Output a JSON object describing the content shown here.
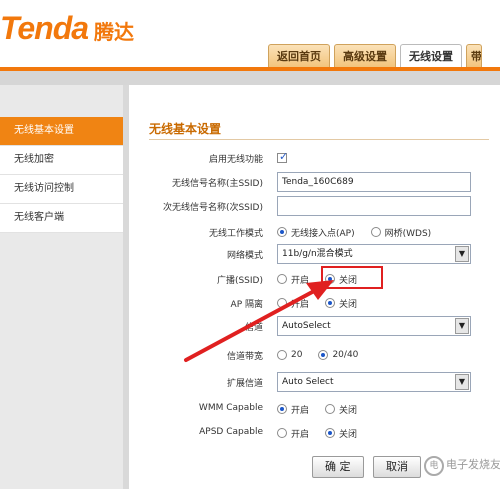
{
  "brand": {
    "logo_text": "Tenda",
    "logo_cn": "腾达"
  },
  "tabs": [
    {
      "label": "返回首页",
      "active": false
    },
    {
      "label": "高级设置",
      "active": false
    },
    {
      "label": "无线设置",
      "active": true
    },
    {
      "label": "带",
      "active": false
    }
  ],
  "sidebar": {
    "items": [
      {
        "label": "无线基本设置",
        "active": true
      },
      {
        "label": "无线加密",
        "active": false
      },
      {
        "label": "无线访问控制",
        "active": false
      },
      {
        "label": "无线客户端",
        "active": false
      }
    ]
  },
  "main": {
    "section_title": "无线基本设置",
    "enable_wireless": {
      "label": "启用无线功能",
      "checked": true
    },
    "ssid_primary": {
      "label": "无线信号名称(主SSID)",
      "value": "Tenda_160C689"
    },
    "ssid_secondary": {
      "label": "次无线信号名称(次SSID)",
      "value": ""
    },
    "work_mode": {
      "label": "无线工作模式",
      "option1": "无线接入点(AP)",
      "option2": "网桥(WDS)",
      "selected": "option1"
    },
    "network_mode": {
      "label": "网络模式",
      "value": "11b/g/n混合模式"
    },
    "broadcast": {
      "label": "广播(SSID)",
      "option_on": "开启",
      "option_off": "关闭",
      "selected": "off"
    },
    "ap_isolation": {
      "label": "AP 隔离",
      "option_on": "开启",
      "option_off": "关闭",
      "selected": "off"
    },
    "channel": {
      "label": "信道",
      "value": "AutoSelect"
    },
    "bandwidth": {
      "label": "信道带宽",
      "option1": "20",
      "option2": "20/40",
      "selected": "option2"
    },
    "ext_channel": {
      "label": "扩展信道",
      "value": "Auto Select"
    },
    "wmm": {
      "label": "WMM Capable",
      "option_on": "开启",
      "option_off": "关闭",
      "selected": "on"
    },
    "apsd": {
      "label": "APSD Capable",
      "option_on": "开启",
      "option_off": "关闭",
      "selected": "off"
    },
    "confirm_label": "确 定",
    "cancel_label": "取消"
  },
  "watermark": {
    "logo": "电",
    "text": "电子发烧友"
  },
  "colors": {
    "brand_orange": "#f2780c",
    "sidebar_active": "#f08413",
    "highlight_red": "#e02020",
    "radio_blue": "#1b56c8"
  },
  "icons": {
    "checkbox_checked": "check-icon",
    "select_arrow": "dropdown-arrow-icon",
    "pointer_arrow": "red-arrow-icon"
  }
}
